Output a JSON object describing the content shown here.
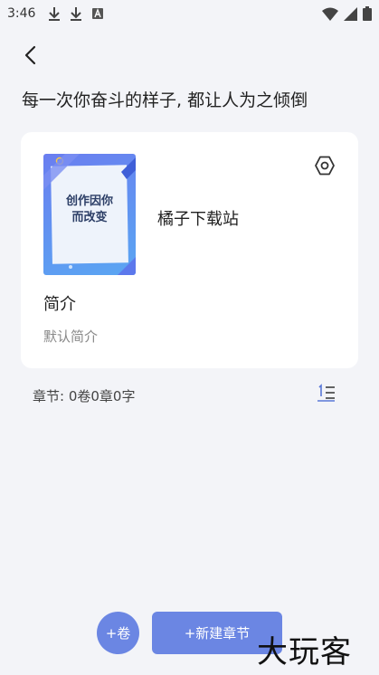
{
  "status_bar": {
    "time": "3:46"
  },
  "header": {
    "motto": "每一次你奋斗的样子, 都让人为之倾倒"
  },
  "book": {
    "cover_text_line1": "创作因你",
    "cover_text_line2": "而改变",
    "name": "橘子下载站",
    "intro_title": "简介",
    "intro_text": "默认简介"
  },
  "chapters": {
    "info": "章节: 0卷0章0字"
  },
  "actions": {
    "add_volume_label": "+卷",
    "new_chapter_label": "+新建章节"
  },
  "watermark": {
    "text": "大玩客"
  },
  "colors": {
    "background": "#f3f4f8",
    "accent": "#6b86e3",
    "card": "#ffffff",
    "muted_text": "#888888"
  }
}
